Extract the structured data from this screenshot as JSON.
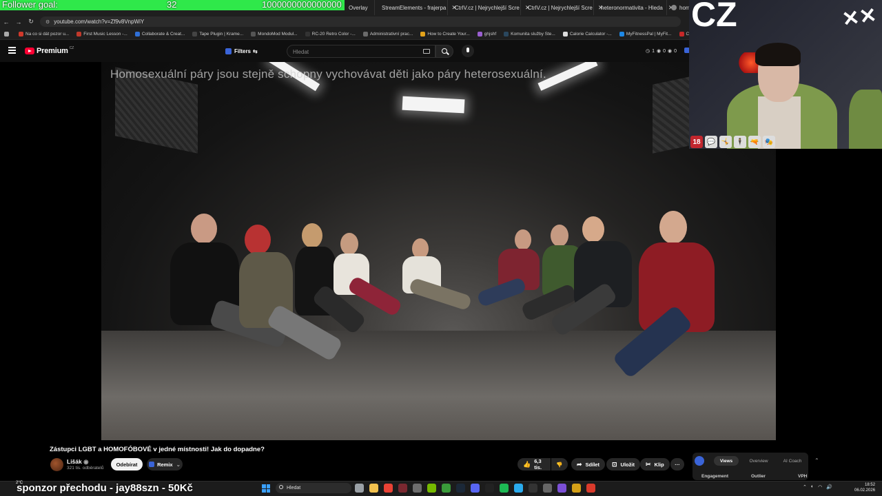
{
  "overlay": {
    "follower_goal_label": "Follower goal:",
    "follower_current": "32",
    "follower_target": "1000000000000000",
    "follower_progress": 3.2e-14,
    "fill_color": "#2fe84a"
  },
  "browser": {
    "tabs": [
      {
        "label": "Overlay",
        "icon": "page-icon"
      },
      {
        "label": "StreamElements - frajerpa",
        "icon": "streamelements-icon"
      },
      {
        "label": "CtrlV.cz | Nejrychlejší Scre",
        "icon": "ctrlv-icon"
      },
      {
        "label": "CtrlV.cz | Nejrychlejší Scre",
        "icon": "ctrlv-icon"
      },
      {
        "label": "heteronormativita - Hleda",
        "icon": "google-icon"
      },
      {
        "label": "homose",
        "icon": "google-icon"
      }
    ],
    "url": "youtube.com/watch?v=Zf9v8VnpWiY",
    "bookmarks": [
      {
        "label": "Na co si dát pozor u...",
        "color": "#d0392b"
      },
      {
        "label": "First Music Lesson -...",
        "color": "#c0392b"
      },
      {
        "label": "Collaborate & Creat...",
        "color": "#2f6fd6"
      },
      {
        "label": "Tape Plugin | Krame...",
        "color": "#444444"
      },
      {
        "label": "MondoMod Modul...",
        "color": "#555555"
      },
      {
        "label": "RC-20 Retro Color -...",
        "color": "#333333"
      },
      {
        "label": "Administrativní prac...",
        "color": "#6b6b6b"
      },
      {
        "label": "How to Create Your...",
        "color": "#e3a21a"
      },
      {
        "label": "ghjshf",
        "color": "#9a5fd0"
      },
      {
        "label": "Komunita služby Ste...",
        "color": "#2a475e"
      },
      {
        "label": "Calorie Calculator -...",
        "color": "#dddddd"
      },
      {
        "label": "MyFitnessPal | MyFit...",
        "color": "#1e88e5"
      },
      {
        "label": "Cha - Cha by Simon...",
        "color": "#c62828"
      }
    ]
  },
  "youtube": {
    "logo_text": "Premium",
    "country": "CZ",
    "filters_label": "Filters",
    "search_placeholder": "Hledat",
    "counters": [
      "1",
      "0",
      "0"
    ]
  },
  "video": {
    "subtitle": "Homosexuální páry jsou stejně schopny vychovávat děti jako páry heterosexuální.",
    "title": "Zástupci LGBT a HOMOFÓBOVÉ v jedné místnosti! Jak do dopadne?",
    "channel_name": "Lišák",
    "channel_subs": "321 tis. odběratelů",
    "subscribe_label": "Odebírat",
    "remix_label": "Remix",
    "likes_label": "6,3 tis.",
    "share_label": "Sdílet",
    "save_label": "Uložit",
    "clip_label": "Klip",
    "more_label": "···"
  },
  "ai_panel": {
    "tabs": [
      "Views",
      "Overview",
      "AI Coach"
    ],
    "active_tab": "Views",
    "columns": [
      "Engagement",
      "Outlier",
      "VPH"
    ]
  },
  "webcam": {
    "overlay_text": "CZ",
    "badges": [
      "18",
      "💬",
      "🤸",
      "🕴",
      "🔫",
      "🎭"
    ]
  },
  "taskbar": {
    "sponsor_text": "sponzor přechodu - jay88szn - 50Kč",
    "weather": "2°C",
    "search_placeholder": "Hledat",
    "time": "18:52",
    "date": "06.02.2026",
    "apps": [
      {
        "name": "task-view-icon",
        "color": "#9aa0a6"
      },
      {
        "name": "file-explorer-icon",
        "color": "#f2c14e"
      },
      {
        "name": "chrome-icon",
        "color": "#e94235"
      },
      {
        "name": "obs-icon",
        "color": "#7a2830"
      },
      {
        "name": "app-icon",
        "color": "#6d6d6d"
      },
      {
        "name": "nvidia-icon",
        "color": "#76b900"
      },
      {
        "name": "xbox-icon",
        "color": "#3a9b3a"
      },
      {
        "name": "steam-icon",
        "color": "#1b2838"
      },
      {
        "name": "discord-icon",
        "color": "#5865f2"
      },
      {
        "name": "tidal-icon",
        "color": "#222222"
      },
      {
        "name": "spotify-icon",
        "color": "#1db954"
      },
      {
        "name": "telegram-icon",
        "color": "#2aabee"
      },
      {
        "name": "epic-icon",
        "color": "#333333"
      },
      {
        "name": "settings-icon",
        "color": "#666666"
      },
      {
        "name": "grid-icon",
        "color": "#7b4fd6"
      },
      {
        "name": "app2-icon",
        "color": "#d4a017"
      },
      {
        "name": "red-app-icon",
        "color": "#d93a2b"
      }
    ]
  }
}
